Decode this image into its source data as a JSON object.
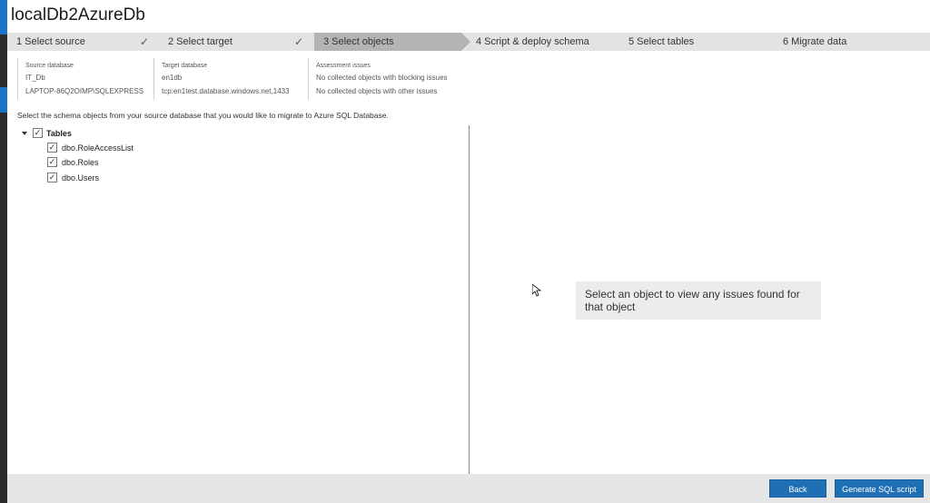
{
  "project": {
    "title": "localDb2AzureDb"
  },
  "steps": [
    {
      "label": "1  Select source",
      "completed": true
    },
    {
      "label": "2  Select target",
      "completed": true
    },
    {
      "label": "3  Select objects",
      "active": true
    },
    {
      "label": "4  Script & deploy schema"
    },
    {
      "label": "5  Select tables"
    },
    {
      "label": "6  Migrate data"
    }
  ],
  "step_check_glyph": "✓",
  "info": {
    "source": {
      "label": "Source database",
      "name": "IT_Db",
      "server": "LAPTOP-86Q2OIMP\\SQLEXPRESS"
    },
    "target": {
      "label": "Target database",
      "name": "en1db",
      "server": "tcp:en1test.database.windows.net,1433"
    },
    "assessment": {
      "label": "Assessment issues",
      "blocking": "No collected objects with blocking issues",
      "other": "No collected objects with other issues"
    }
  },
  "instructions": "Select the schema objects from your source database that you would like to migrate to Azure SQL Database.",
  "tree": {
    "root": {
      "label": "Tables",
      "checked": true,
      "expanded": true
    },
    "children": [
      {
        "label": "dbo.RoleAccessList",
        "checked": true
      },
      {
        "label": "dbo.Roles",
        "checked": true
      },
      {
        "label": "dbo.Users",
        "checked": true
      }
    ]
  },
  "check_glyph": "✓",
  "details_pane": {
    "empty_message": "Select an object to view any issues found for that object"
  },
  "footer": {
    "back_label": "Back",
    "generate_label": "Generate SQL script"
  },
  "colors": {
    "accent": "#1e6fb4",
    "step_bar": "#e3e3e3",
    "step_active": "#b4b4b4"
  }
}
